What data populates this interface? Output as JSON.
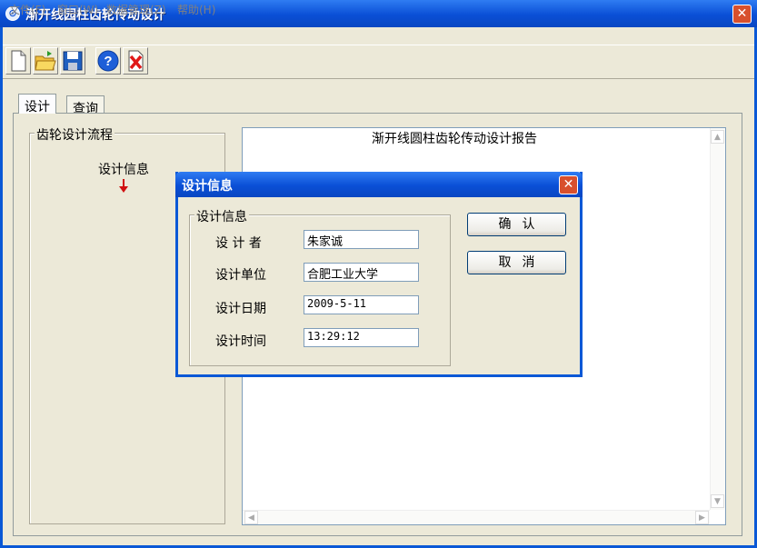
{
  "window": {
    "title": "渐开线园柱齿轮传动设计"
  },
  "menu": [
    "文件(F)",
    "窗口(W)",
    "数据管理(Z)",
    "帮助(H)"
  ],
  "toolbar": [
    "new-file-icon",
    "open-folder-icon",
    "save-icon",
    "help-icon",
    "delete-icon"
  ],
  "tabs": [
    {
      "label": "设计"
    },
    {
      "label": "查询"
    }
  ],
  "flow": {
    "group_label": "齿轮设计流程",
    "step": "设计信息"
  },
  "report": {
    "title": "渐开线圆柱齿轮传动设计报告"
  },
  "dialog": {
    "title": "设计信息",
    "group_label": "设计信息",
    "fields": [
      {
        "label": "设 计 者",
        "value": "朱家诚"
      },
      {
        "label": "设计单位",
        "value": "合肥工业大学"
      },
      {
        "label": "设计日期",
        "value": "2009-5-11"
      },
      {
        "label": "设计时间",
        "value": "13:29:12"
      }
    ],
    "ok_label": "确认",
    "cancel_label": "取消"
  },
  "colors": {
    "title_bar": "#0a4fd6",
    "close": "#d8502d",
    "background": "#ece9d8"
  }
}
